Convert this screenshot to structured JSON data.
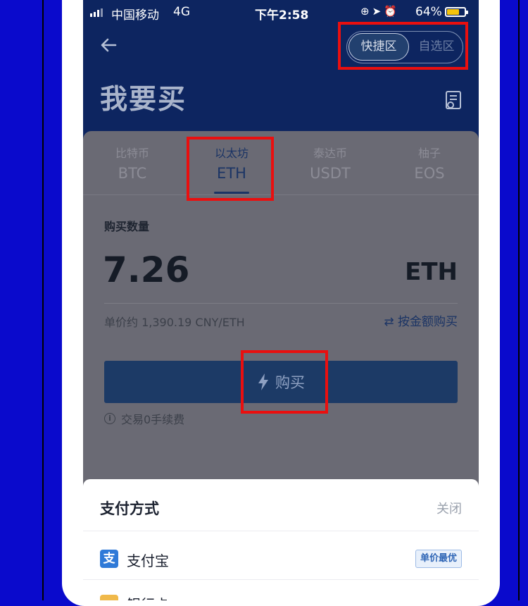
{
  "status_bar": {
    "carrier": "中国移动",
    "network": "4G",
    "time": "下午2:58",
    "battery_percent": "64%",
    "icons": [
      "signal-icon",
      "lock-rotation-icon",
      "location-icon",
      "alarm-icon",
      "battery-icon"
    ]
  },
  "header": {
    "title": "我要买",
    "segments": [
      "快捷区",
      "自选区"
    ],
    "active_segment": "快捷区"
  },
  "coin_tabs": [
    {
      "cn": "比特币",
      "en": "BTC"
    },
    {
      "cn": "以太坊",
      "en": "ETH"
    },
    {
      "cn": "泰达币",
      "en": "USDT"
    },
    {
      "cn": "柚子",
      "en": "EOS"
    }
  ],
  "active_tab": "ETH",
  "purchase": {
    "quantity_label": "购买数量",
    "quantity": "7.26",
    "unit": "ETH",
    "unit_price": "单价约 1,390.19 CNY/ETH",
    "switch_label": "按金额购买",
    "buy_label": "购买",
    "fee_note": "交易0手续费"
  },
  "payment_sheet": {
    "title": "支付方式",
    "close_label": "关闭",
    "options": [
      {
        "icon": "支",
        "name": "支付宝",
        "badge": "单价最优"
      },
      {
        "name": "银行卡"
      }
    ]
  },
  "colors": {
    "page_background": "#0a0acc",
    "header_navy": "#0d2560",
    "overlay_gray": "#6a6a74",
    "buy_button": "#1c3a66",
    "highlight_red": "#ea0f0f",
    "alipay_blue": "#2f7ad8"
  }
}
